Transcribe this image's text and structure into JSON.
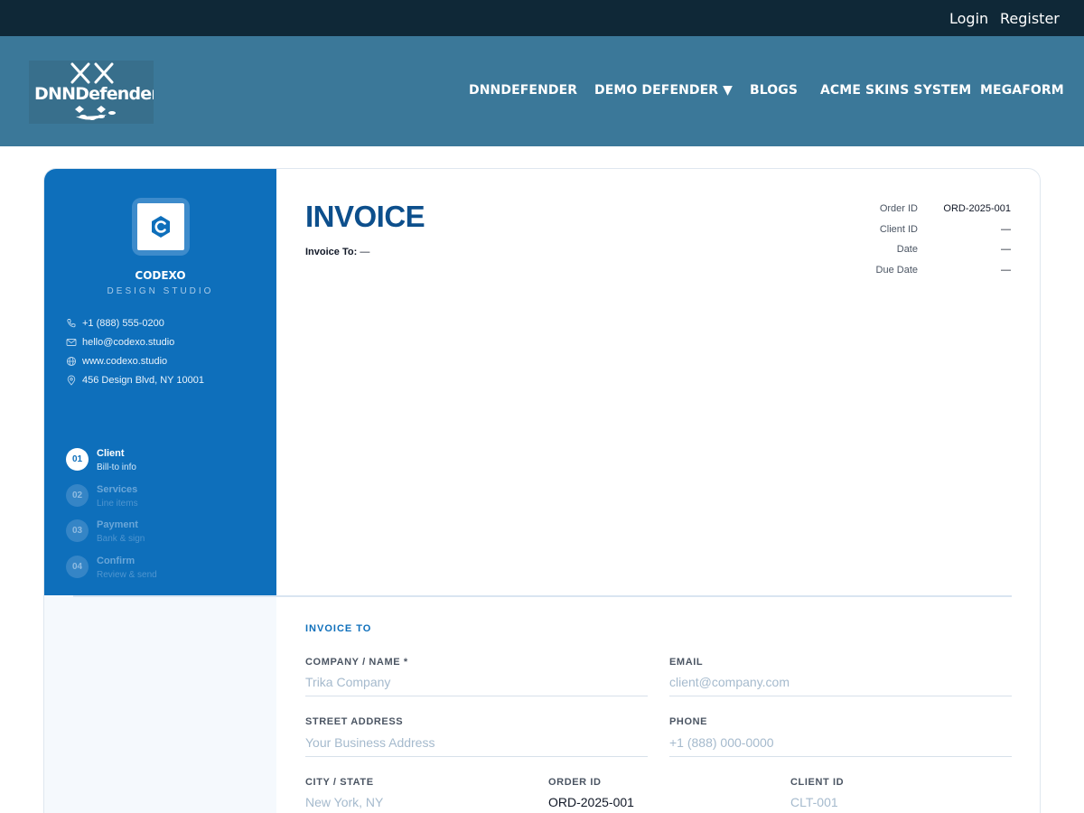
{
  "topbar": {
    "login": "Login",
    "register": "Register"
  },
  "header": {
    "logo_text": "DNNDefender",
    "nav": [
      "DNNDEFENDER",
      "DEMO DEFENDER ▼",
      "BLOGS",
      "ACME SKINS SYSTEM",
      "MEGAFORM"
    ]
  },
  "sidebar": {
    "brand_name": "CODEXO",
    "brand_sub": "DESIGN STUDIO",
    "brand_icon": "hexagon-c-logo-icon",
    "contacts": [
      {
        "icon": "phone-icon",
        "text": "+1 (888) 555-0200"
      },
      {
        "icon": "mail-icon",
        "text": "hello@codexo.studio"
      },
      {
        "icon": "globe-icon",
        "text": "www.codexo.studio"
      },
      {
        "icon": "map-pin-icon",
        "text": "456 Design Blvd, NY 10001"
      }
    ],
    "steps": [
      {
        "num": "01",
        "title": "Client",
        "subtitle": "Bill-to info",
        "active": true
      },
      {
        "num": "02",
        "title": "Services",
        "subtitle": "Line items",
        "active": false
      },
      {
        "num": "03",
        "title": "Payment",
        "subtitle": "Bank & sign",
        "active": false
      },
      {
        "num": "04",
        "title": "Confirm",
        "subtitle": "Review & send",
        "active": false
      }
    ]
  },
  "invoice": {
    "title": "INVOICE",
    "invoice_to_label": "Invoice To:",
    "invoice_to_value": "—",
    "meta": [
      {
        "label": "Order ID",
        "value": "ORD-2025-001"
      },
      {
        "label": "Client ID",
        "value": "—"
      },
      {
        "label": "Date",
        "value": "—"
      },
      {
        "label": "Due Date",
        "value": "—"
      }
    ]
  },
  "form": {
    "section_title": "INVOICE TO",
    "company": {
      "label": "COMPANY / NAME *",
      "value": "",
      "placeholder": "Trika Company"
    },
    "email": {
      "label": "EMAIL",
      "value": "",
      "placeholder": "client@company.com"
    },
    "street": {
      "label": "STREET ADDRESS",
      "value": "",
      "placeholder": "Your Business Address"
    },
    "phone": {
      "label": "PHONE",
      "value": "",
      "placeholder": "+1 (888) 000-0000"
    },
    "city": {
      "label": "CITY / STATE",
      "value": "",
      "placeholder": "New York, NY"
    },
    "order_id": {
      "label": "ORDER ID",
      "value": "ORD-2025-001",
      "placeholder": ""
    },
    "client_id": {
      "label": "CLIENT ID",
      "value": "",
      "placeholder": "CLT-001"
    }
  },
  "colors": {
    "topbar": "#0f2837",
    "header": "#3b7899",
    "sidebar": "#0e6fbb",
    "accent": "#0e6fbb",
    "title": "#0d4f8c"
  }
}
